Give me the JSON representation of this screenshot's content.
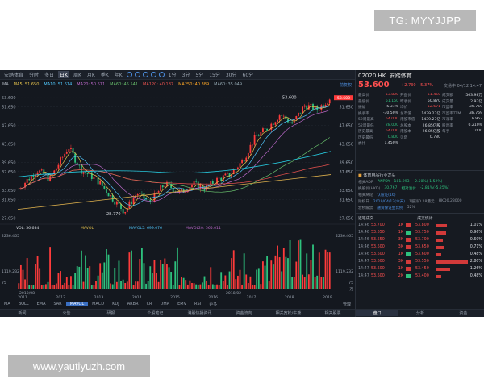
{
  "watermarks": {
    "top": "TG: MYYJJPP",
    "bottom": "www.yautiyuzh.com"
  },
  "toolbar": {
    "items": [
      "安踏体育",
      "分时",
      "多日",
      "日K",
      "周K",
      "月K",
      "季K",
      "年K",
      "1分",
      "3分",
      "5分",
      "15分",
      "30分",
      "60分"
    ],
    "active_index": 3
  },
  "ma_legend": {
    "label": "MA",
    "items": [
      "MA5: 51.650",
      "MA10: 51.614",
      "MA20: 50.611",
      "MA60: 45.541",
      "MA120: 40.187",
      "MA250: 40.389",
      "MA60: 35.049"
    ],
    "right": "前复权"
  },
  "chart_labels": {
    "price_ticks": [
      "53.600",
      "51.650",
      "47.650",
      "43.650",
      "39.650",
      "37.650",
      "33.650",
      "31.650",
      "27.650"
    ],
    "year_ticks": [
      "2011",
      "2012",
      "2013",
      "2014",
      "2015",
      "2016",
      "2017",
      "2018",
      "2019"
    ],
    "low_label": "28.770",
    "high_label": "53.600",
    "vol_legend": [
      "VOL: 56.684",
      "MAVOL",
      "MAVOL5: 699.076",
      "MAVOL20: 565.011"
    ],
    "vol_ticks": [
      "2236.465",
      "1119.232",
      "75"
    ],
    "vol_unit": "万",
    "vol_dates": [
      "2010/08",
      "2018/02"
    ],
    "colors": {
      "up": "#ff3b3b",
      "down": "#2ec27e",
      "bg": "#14181f",
      "grid": "#242a33"
    }
  },
  "indicator_tabs": {
    "items": [
      "MA",
      "BOLL",
      "EMA",
      "SAR",
      "MAVOL",
      "MACD",
      "KDJ",
      "ARBR",
      "CR",
      "DMA",
      "EMV",
      "RSI",
      "更多"
    ],
    "active_index": 4,
    "right": "管理"
  },
  "bottom_tabs": {
    "items": [
      "新闻",
      "公告",
      "研报",
      "个股笔记",
      "港股快播资讯",
      "资金流向",
      "相关宽松/牛熊",
      "相关股票"
    ],
    "active_index": -1
  },
  "quote": {
    "code": "02020.HK",
    "name": "安踏体育",
    "price": "53.600",
    "change": "+2.730 +5.37%",
    "time": "交易中 04/12 14:47",
    "fields": [
      {
        "k": "最高价",
        "v": "53.800",
        "c": "red"
      },
      {
        "k": "开盘价",
        "v": "51.450",
        "c": "red"
      },
      {
        "k": "成交额",
        "v": "563.98万",
        "c": "white"
      },
      {
        "k": "最低价",
        "v": "51.150",
        "c": "green"
      },
      {
        "k": "昨收价",
        "v": "50.870",
        "c": "white"
      },
      {
        "k": "成交量",
        "v": "2.97亿",
        "c": "white"
      },
      {
        "k": "振幅",
        "v": "5.31%",
        "c": "white"
      },
      {
        "k": "均价",
        "v": "52.671",
        "c": "red"
      },
      {
        "k": "市盈率",
        "v": "36.769",
        "c": "white"
      },
      {
        "k": "换手率",
        "v": "-30.50%",
        "c": "white"
      },
      {
        "k": "总市值",
        "v": "1439.27亿",
        "c": "white"
      },
      {
        "k": "市盈率TTM",
        "v": "38.769",
        "c": "white"
      },
      {
        "k": "52周最高",
        "v": "54.000",
        "c": "red"
      },
      {
        "k": "港股市值",
        "v": "1439.27亿",
        "c": "white"
      },
      {
        "k": "市净率",
        "v": "8.962",
        "c": "white"
      },
      {
        "k": "52周最低",
        "v": "28.000",
        "c": "green"
      },
      {
        "k": "总股本",
        "v": "26.85亿股",
        "c": "white"
      },
      {
        "k": "股息率",
        "v": "0.210%",
        "c": "white"
      },
      {
        "k": "历史最高",
        "v": "54.000",
        "c": "red"
      },
      {
        "k": "港股本",
        "v": "26.85亿股",
        "c": "white"
      },
      {
        "k": "每手",
        "v": "1000",
        "c": "white"
      },
      {
        "k": "历史最低",
        "v": "0.800",
        "c": "green"
      },
      {
        "k": "贝塔",
        "v": "0.780",
        "c": "white"
      },
      {
        "k": "",
        "v": "",
        "c": "white"
      },
      {
        "k": "委比",
        "v": "1.450%",
        "c": "white"
      },
      {
        "k": "",
        "v": "",
        "c": "white"
      },
      {
        "k": "",
        "v": "",
        "c": "white"
      }
    ],
    "section1": "体育用品行业龙头",
    "lines": [
      {
        "a": "相关ADR",
        "b": "ANPDY",
        "c": "181.993",
        "d": "-2.50%(-1.52%)",
        "cls": "green"
      },
      {
        "a": "换股价(HKD)",
        "b": "30.767",
        "c": "相对溢价",
        "d": "-2.81%(-5.25%)",
        "cls": "green"
      },
      {
        "a": "相关窝轮",
        "b": "认股证(16)",
        "c": "",
        "d": "",
        "cls": "white"
      },
      {
        "a": "除权日",
        "b": "2019/04/12(今天)",
        "c": "1股派0.28港元",
        "d": "HKD0.28000",
        "cls": "white"
      },
      {
        "a": "宏桥解禁",
        "b": "融资保证金比例",
        "c": "52%",
        "d": "",
        "cls": "white"
      }
    ],
    "dist_header": [
      "逐笔成交",
      "成交统计"
    ],
    "dist_rows": [
      {
        "t": "14:46",
        "p": "53.700",
        "q": "1K",
        "p2": "53.800",
        "pct": "1.01%",
        "w": 14
      },
      {
        "t": "14:46",
        "p": "53.650",
        "q": "1K",
        "p2": "53.750",
        "pct": "0.96%",
        "w": 13
      },
      {
        "t": "14:46",
        "p": "53.650",
        "q": "3K",
        "p2": "53.700",
        "pct": "0.60%",
        "w": 9
      },
      {
        "t": "14:46",
        "p": "53.600",
        "q": "3K",
        "p2": "53.650",
        "pct": "0.71%",
        "w": 10
      },
      {
        "t": "14:46",
        "p": "53.600",
        "q": "1K",
        "p2": "53.600",
        "pct": "0.48%",
        "w": 7
      },
      {
        "t": "14:47",
        "p": "53.600",
        "q": "3K",
        "p2": "53.550",
        "pct": "2.80%",
        "w": 40
      },
      {
        "t": "14:47",
        "p": "53.600",
        "q": "1K",
        "p2": "53.450",
        "pct": "1.26%",
        "w": 18
      },
      {
        "t": "14:47",
        "p": "53.600",
        "q": "2K",
        "p2": "53.400",
        "pct": "0.48%",
        "w": 7
      }
    ],
    "sidebar_tabs": [
      "盘口",
      "分析",
      "资金"
    ],
    "sidebar_tab_active": 0
  }
}
